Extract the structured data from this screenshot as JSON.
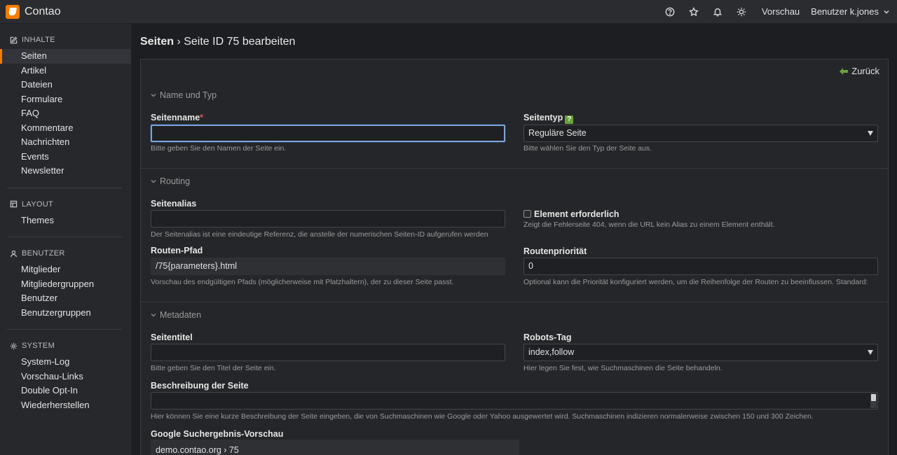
{
  "app": {
    "name": "Contao"
  },
  "topbar": {
    "help_icon": "help-circle-icon",
    "favorites_icon": "star-icon",
    "notifications_icon": "bell-icon",
    "theme_icon": "sun-icon",
    "preview_label": "Vorschau",
    "user_label": "Benutzer k.jones"
  },
  "sidebar": {
    "groups": [
      {
        "title": "Inhalte",
        "icon": "edit-icon",
        "items": [
          "Seiten",
          "Artikel",
          "Dateien",
          "Formulare",
          "FAQ",
          "Kommentare",
          "Nachrichten",
          "Events",
          "Newsletter"
        ]
      },
      {
        "title": "Layout",
        "icon": "layout-icon",
        "items": [
          "Themes"
        ]
      },
      {
        "title": "Benutzer",
        "icon": "user-icon",
        "items": [
          "Mitglieder",
          "Mitgliedergruppen",
          "Benutzer",
          "Benutzergruppen"
        ]
      },
      {
        "title": "System",
        "icon": "gear-icon",
        "items": [
          "System-Log",
          "Vorschau-Links",
          "Double Opt-In",
          "Wiederherstellen"
        ]
      }
    ],
    "active_item": "Seiten"
  },
  "main": {
    "breadcrumb_root": "Seiten",
    "breadcrumb_sep": " › ",
    "breadcrumb_current": "Seite ID 75 bearbeiten",
    "back_label": "Zurück",
    "sections": {
      "name_type": "Name und Typ",
      "routing": "Routing",
      "metadata": "Metadaten"
    },
    "fields": {
      "page_name": {
        "label": "Seitenname",
        "required_mark": "*",
        "value": "",
        "help": "Bitte geben Sie den Namen der Seite ein."
      },
      "page_type": {
        "label": "Seitentyp",
        "help_badge": "?",
        "value": "Reguläre Seite",
        "help": "Bitte wählen Sie den Typ der Seite aus."
      },
      "page_alias": {
        "label": "Seitenalias",
        "value": "",
        "help": "Der Seitenalias ist eine eindeutige Referenz, die anstelle der numerischen Seiten-ID aufgerufen werden"
      },
      "require_item": {
        "label": "Element erforderlich",
        "checked": false,
        "help": "Zeigt die Fehlerseite 404, wenn die URL kein Alias zu einem Element enthält."
      },
      "route_path": {
        "label": "Routen-Pfad",
        "value": "/75{parameters}.html",
        "help": "Vorschau des endgültigen Pfads (möglicherweise mit Platzhaltern), der zu dieser Seite passt."
      },
      "route_priority": {
        "label": "Routenpriorität",
        "value": "0",
        "help": "Optional kann die Priorität konfiguriert werden, um die Reihenfolge der Routen zu beeinflussen. Standard:"
      },
      "page_title": {
        "label": "Seitentitel",
        "value": "",
        "help": "Bitte geben Sie den Titel der Seite ein."
      },
      "robots": {
        "label": "Robots-Tag",
        "value": "index,follow",
        "help": "Hier legen Sie fest, wie Suchmaschinen die Seite behandeln."
      },
      "description": {
        "label": "Beschreibung der Seite",
        "value": "",
        "help": "Hier können Sie eine kurze Beschreibung der Seite eingeben, die von Suchmaschinen wie Google oder Yahoo ausgewertet wird. Suchmaschinen indizieren normalerweise zwischen 150 und 300 Zeichen."
      },
      "serp_preview": {
        "label": "Google Suchergebnis-Vorschau",
        "url": "demo.contao.org › 75"
      }
    }
  },
  "colors": {
    "accent": "#f47c00",
    "focus": "#7ea4d8",
    "required": "#e34f4f",
    "help_badge": "#6aa23c"
  }
}
